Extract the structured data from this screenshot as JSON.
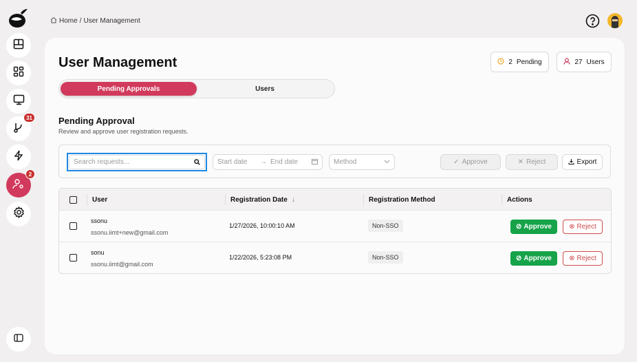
{
  "breadcrumb": {
    "home": "Home",
    "separator": "/",
    "current": "User Management"
  },
  "sidebar": {
    "badges": {
      "git": "31",
      "users": "2"
    }
  },
  "page": {
    "title": "User Management"
  },
  "stats": {
    "pending_count": "2",
    "pending_label": "Pending",
    "users_count": "27",
    "users_label": "Users"
  },
  "tabs": [
    {
      "label": "Pending Approvals",
      "active": true
    },
    {
      "label": "Users",
      "active": false
    }
  ],
  "section": {
    "title": "Pending Approval",
    "subtitle": "Review and approve user registration requests."
  },
  "filters": {
    "search_placeholder": "Search requests...",
    "start_date_placeholder": "Start date",
    "end_date_placeholder": "End date",
    "method_placeholder": "Method",
    "approve": "Approve",
    "reject": "Reject",
    "export": "Export"
  },
  "table": {
    "headers": {
      "user": "User",
      "date": "Registration Date",
      "method": "Registration Method",
      "actions": "Actions"
    },
    "rows": [
      {
        "name": "ssonu",
        "email": "ssonu.iimt+new@gmail.com",
        "date": "1/27/2026, 10:00:10 AM",
        "method": "Non-SSO",
        "approve": "Approve",
        "reject": "Reject"
      },
      {
        "name": "sonu",
        "email": "ssonu.iimt@gmail.com",
        "date": "1/22/2026, 5:23:08 PM",
        "method": "Non-SSO",
        "approve": "Approve",
        "reject": "Reject"
      }
    ]
  },
  "colors": {
    "accent": "#d13a5c",
    "approve": "#16a34a",
    "reject": "#d04a4a",
    "focus": "#1e88e5"
  }
}
